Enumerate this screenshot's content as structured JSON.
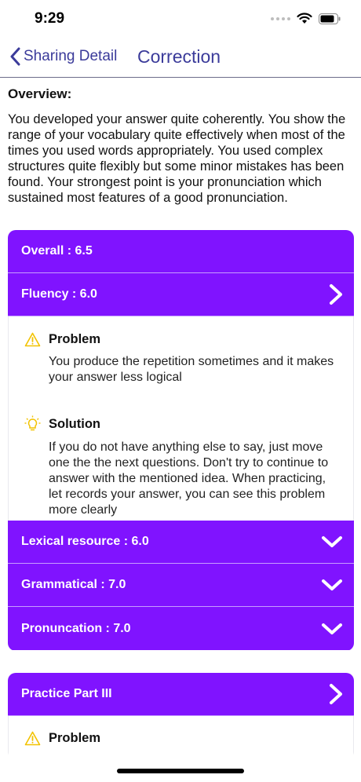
{
  "status_bar": {
    "time": "9:29"
  },
  "nav": {
    "back_label": "Sharing Detail",
    "title": "Correction"
  },
  "overview": {
    "heading": "Overview:",
    "text": "You developed your answer quite coherently. You show the range of your vocabulary quite effectively when most of the times you used words appropriately. You used complex structures quite flexibly but some minor mistakes has been found. Your strongest point is your pronunciation which sustained most features of a good pronunciation."
  },
  "score_card": {
    "overall": "Overall : 6.5",
    "fluency": {
      "label": "Fluency : 6.0",
      "problem_title": "Problem",
      "problem_text": "You produce the repetition sometimes and it makes your answer less logical",
      "solution_title": "Solution",
      "solution_text": "If you do not have anything else to say, just move one the the next questions. Don't try to continue to answer with the mentioned idea. When practicing, let records your answer, you can see this problem more clearly"
    },
    "lexical": "Lexical resource : 6.0",
    "grammatical": "Grammatical : 7.0",
    "pronunciation": "Pronuncation : 7.0"
  },
  "practice_card": {
    "label": "Practice Part III",
    "problem_title": "Problem"
  },
  "colors": {
    "accent_purple": "#8013ff",
    "nav_purple": "#3b3b9a",
    "warning_yellow": "#f2c200"
  },
  "icons": {
    "back": "chevron-left-icon",
    "expand_right": "chevron-right-icon",
    "expand_down": "chevron-down-icon",
    "problem": "warning-triangle-icon",
    "solution": "lightbulb-icon"
  }
}
